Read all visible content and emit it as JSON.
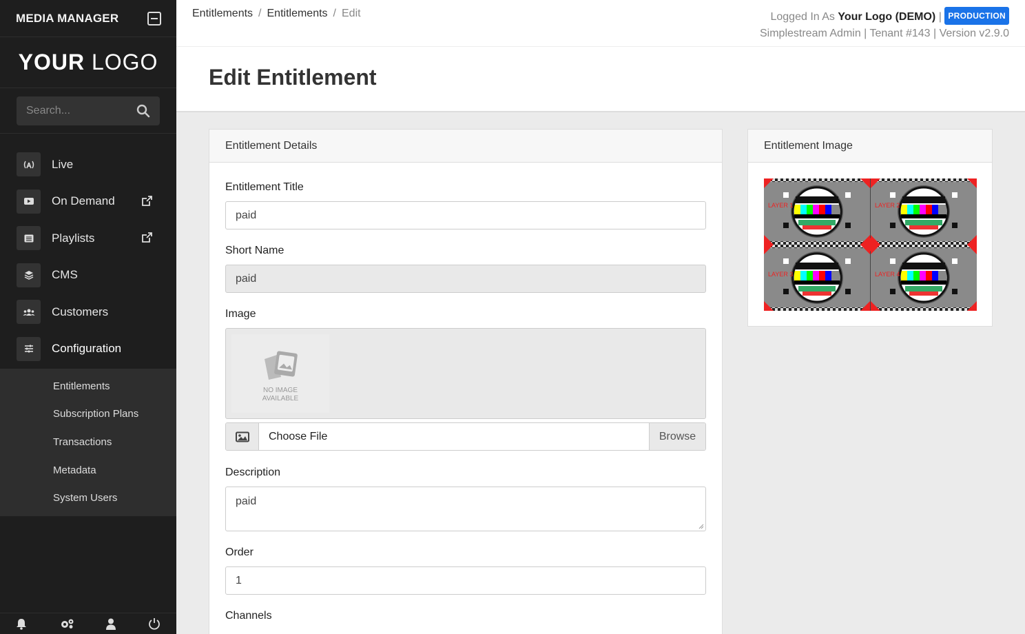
{
  "sidebar": {
    "app_title": "MEDIA MANAGER",
    "logo_bold": "YOUR",
    "logo_light": "LOGO",
    "search_placeholder": "Search...",
    "items": [
      {
        "label": "Live",
        "icon": "broadcast-icon"
      },
      {
        "label": "On Demand",
        "icon": "video-icon",
        "external": true
      },
      {
        "label": "Playlists",
        "icon": "list-icon",
        "external": true
      },
      {
        "label": "CMS",
        "icon": "layers-icon"
      },
      {
        "label": "Customers",
        "icon": "users-icon"
      },
      {
        "label": "Configuration",
        "icon": "sliders-icon",
        "active": true
      }
    ],
    "subitems": [
      "Entitlements",
      "Subscription Plans",
      "Transactions",
      "Metadata",
      "System Users"
    ],
    "footer_icons": [
      "bell-icon",
      "gears-icon",
      "user-icon",
      "power-icon"
    ]
  },
  "topbar": {
    "breadcrumb": [
      "Entitlements",
      "Entitlements",
      "Edit"
    ],
    "logged_in_prefix": "Logged In As",
    "user_name": "Your Logo (DEMO)",
    "env_badge": "PRODUCTION",
    "meta_line": "Simplestream Admin | Tenant #143 | Version v2.9.0"
  },
  "page": {
    "title": "Edit Entitlement"
  },
  "details_card": {
    "header": "Entitlement Details",
    "title_label": "Entitlement Title",
    "title_value": "paid",
    "short_label": "Short Name",
    "short_value": "paid",
    "image_label": "Image",
    "no_image_text_1": "NO IMAGE",
    "no_image_text_2": "AVAILABLE",
    "choose_file": "Choose File",
    "browse": "Browse",
    "description_label": "Description",
    "description_value": "paid",
    "order_label": "Order",
    "order_value": "1",
    "channels_label": "Channels"
  },
  "image_card": {
    "header": "Entitlement Image",
    "layer_labels": [
      "LAYER 1",
      "LAYER 2",
      "LAYER 3",
      "LAYER 4"
    ]
  },
  "colors": {
    "sidebar_bg": "#1e1e1e",
    "badge_blue": "#1a73e8"
  }
}
